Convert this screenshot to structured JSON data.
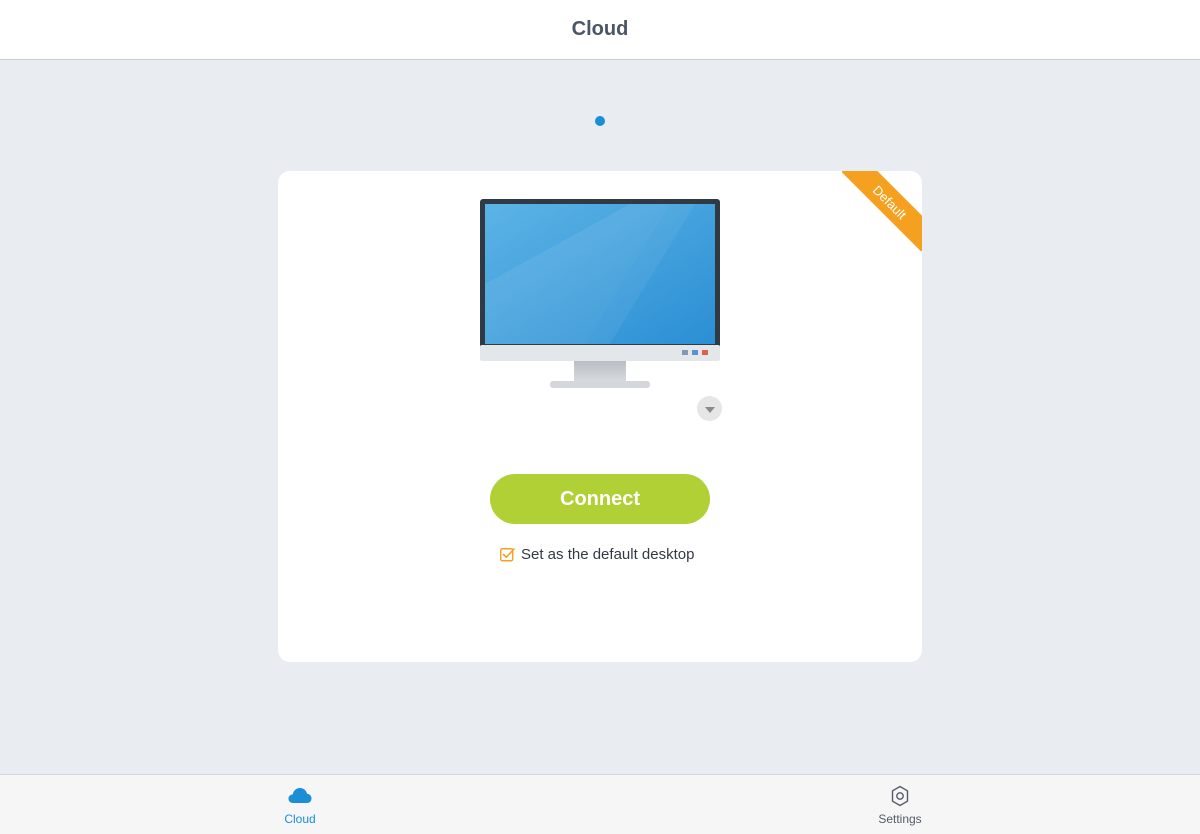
{
  "header": {
    "title": "Cloud"
  },
  "card": {
    "badge": "Default",
    "connect_label": "Connect",
    "default_checkbox": {
      "label": "Set as the default desktop",
      "checked": true
    }
  },
  "tabbar": {
    "tabs": [
      {
        "label": "Cloud",
        "icon": "cloud-icon",
        "active": true
      },
      {
        "label": "Settings",
        "icon": "gear-icon",
        "active": false
      }
    ]
  },
  "colors": {
    "accent": "#1a8fd6",
    "connect": "#b0d035",
    "badge": "#f5a01f",
    "background": "#e9ecf1"
  }
}
